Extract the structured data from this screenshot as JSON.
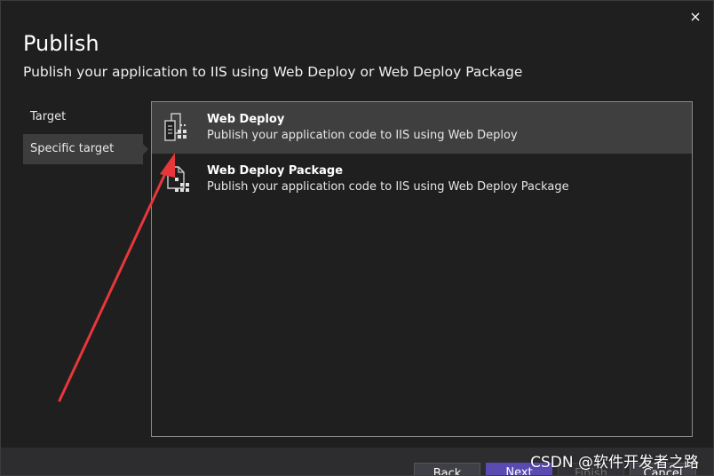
{
  "dialog": {
    "title": "Publish",
    "subtitle": "Publish your application to IIS using Web Deploy or Web Deploy Package",
    "close_icon": "close-icon"
  },
  "nav": {
    "items": [
      {
        "label": "Target",
        "selected": false
      },
      {
        "label": "Specific target",
        "selected": true
      }
    ]
  },
  "options": [
    {
      "title": "Web Deploy",
      "description": "Publish your application code to IIS using Web Deploy",
      "icon": "web-deploy-icon",
      "selected": true
    },
    {
      "title": "Web Deploy Package",
      "description": "Publish your application code to IIS using Web Deploy Package",
      "icon": "web-deploy-package-icon",
      "selected": false
    }
  ],
  "footer": {
    "back_label": "Back",
    "next_label": "Next",
    "finish_label": "Finish",
    "cancel_label": "Cancel"
  },
  "annotation": {
    "arrow_color": "#e8373b"
  },
  "watermark": "CSDN @软件开发者之路",
  "colors": {
    "background": "#1f1f1f",
    "selected": "#3f3f3f",
    "accent": "#5a4bb2"
  }
}
